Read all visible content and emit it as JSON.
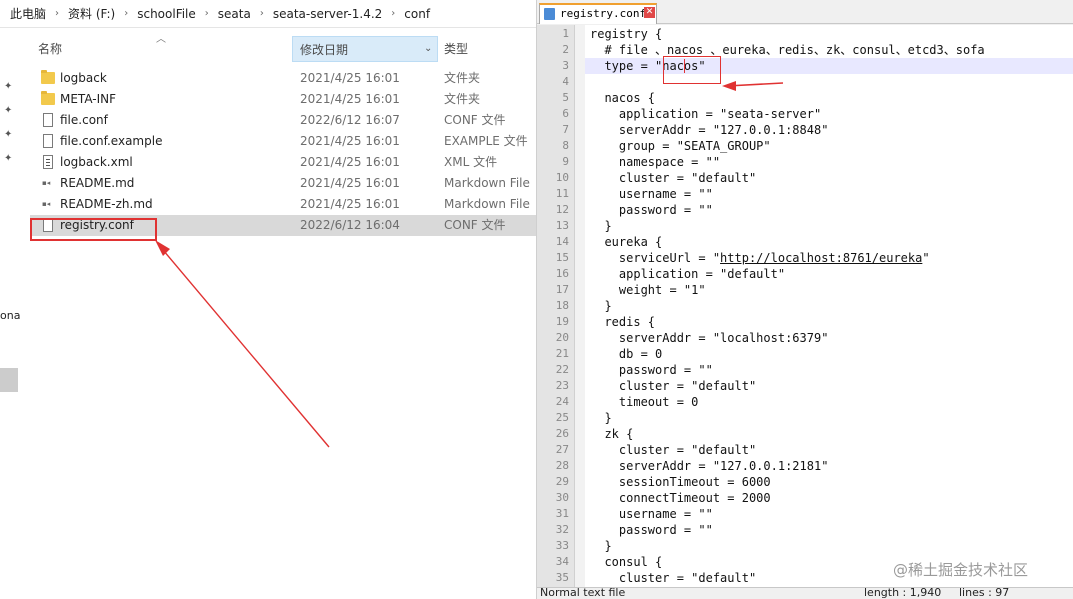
{
  "breadcrumb": {
    "items": [
      "此电脑",
      "资料 (F:)",
      "schoolFile",
      "seata",
      "seata-server-1.4.2",
      "conf"
    ],
    "separator": "›"
  },
  "nav": {
    "cut_text": "ona"
  },
  "columns": {
    "name": "名称",
    "date": "修改日期",
    "type": "类型"
  },
  "files": [
    {
      "name": "logback",
      "date": "2021/4/25 16:01",
      "type": "文件夹",
      "icon": "folder-icon"
    },
    {
      "name": "META-INF",
      "date": "2021/4/25 16:01",
      "type": "文件夹",
      "icon": "folder-icon"
    },
    {
      "name": "file.conf",
      "date": "2022/6/12 16:07",
      "type": "CONF 文件",
      "icon": "file-icon"
    },
    {
      "name": "file.conf.example",
      "date": "2021/4/25 16:01",
      "type": "EXAMPLE 文件",
      "icon": "file-icon"
    },
    {
      "name": "logback.xml",
      "date": "2021/4/25 16:01",
      "type": "XML 文件",
      "icon": "xml-icon"
    },
    {
      "name": "README.md",
      "date": "2021/4/25 16:01",
      "type": "Markdown File",
      "icon": "markdown-icon"
    },
    {
      "name": "README-zh.md",
      "date": "2021/4/25 16:01",
      "type": "Markdown File",
      "icon": "markdown-icon"
    },
    {
      "name": "registry.conf",
      "date": "2022/6/12 16:04",
      "type": "CONF 文件",
      "icon": "file-icon",
      "selected": true
    }
  ],
  "editor": {
    "tab_label": "registry.conf",
    "lines": [
      {
        "n": "1",
        "text": "registry {"
      },
      {
        "n": "2",
        "text": "  # file 、nacos 、eureka、redis、zk、consul、etcd3、sofa"
      },
      {
        "n": "3",
        "text": "  type = \"nacos\""
      },
      {
        "n": "4",
        "text": ""
      },
      {
        "n": "5",
        "text": "  nacos {"
      },
      {
        "n": "6",
        "text": "    application = \"seata-server\""
      },
      {
        "n": "7",
        "text": "    serverAddr = \"127.0.0.1:8848\""
      },
      {
        "n": "8",
        "text": "    group = \"SEATA_GROUP\""
      },
      {
        "n": "9",
        "text": "    namespace = \"\""
      },
      {
        "n": "10",
        "text": "    cluster = \"default\""
      },
      {
        "n": "11",
        "text": "    username = \"\""
      },
      {
        "n": "12",
        "text": "    password = \"\""
      },
      {
        "n": "13",
        "text": "  }"
      },
      {
        "n": "14",
        "text": "  eureka {"
      },
      {
        "n": "15",
        "text": "    serviceUrl = \"http://localhost:8761/eureka\""
      },
      {
        "n": "16",
        "text": "    application = \"default\""
      },
      {
        "n": "17",
        "text": "    weight = \"1\""
      },
      {
        "n": "18",
        "text": "  }"
      },
      {
        "n": "19",
        "text": "  redis {"
      },
      {
        "n": "20",
        "text": "    serverAddr = \"localhost:6379\""
      },
      {
        "n": "21",
        "text": "    db = 0"
      },
      {
        "n": "22",
        "text": "    password = \"\""
      },
      {
        "n": "23",
        "text": "    cluster = \"default\""
      },
      {
        "n": "24",
        "text": "    timeout = 0"
      },
      {
        "n": "25",
        "text": "  }"
      },
      {
        "n": "26",
        "text": "  zk {"
      },
      {
        "n": "27",
        "text": "    cluster = \"default\""
      },
      {
        "n": "28",
        "text": "    serverAddr = \"127.0.0.1:2181\""
      },
      {
        "n": "29",
        "text": "    sessionTimeout = 6000"
      },
      {
        "n": "30",
        "text": "    connectTimeout = 2000"
      },
      {
        "n": "31",
        "text": "    username = \"\""
      },
      {
        "n": "32",
        "text": "    password = \"\""
      },
      {
        "n": "33",
        "text": "  }"
      },
      {
        "n": "34",
        "text": "  consul {"
      },
      {
        "n": "35",
        "text": "    cluster = \"default\""
      }
    ],
    "link_text": "http://localhost:8761/eureka"
  },
  "status": {
    "file_type": "Normal text file",
    "length": "length : 1,940",
    "lines": "lines : 97"
  },
  "watermark": "@稀土掘金技术社区",
  "colors": {
    "annotation_red": "#e03232",
    "selected_row": "#d9d9d9",
    "current_line": "#e8e8ff"
  }
}
